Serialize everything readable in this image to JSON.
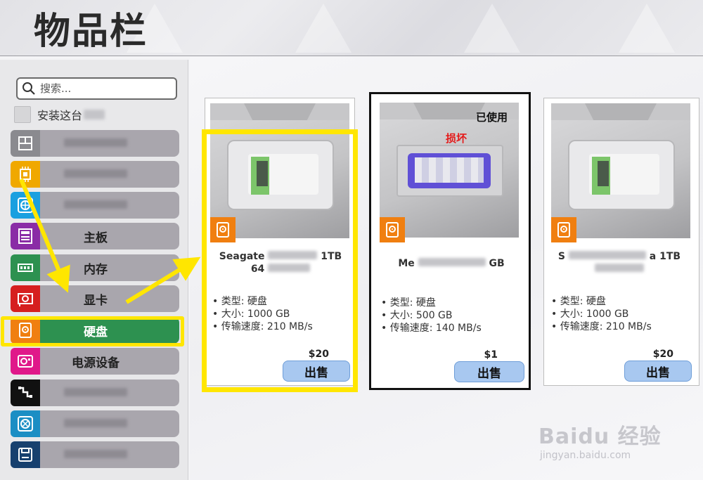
{
  "header": {
    "title": "物品栏"
  },
  "sidebar": {
    "search_placeholder": "搜索...",
    "install_label": "安装这台",
    "categories": [
      {
        "label": "",
        "icon": "case-icon",
        "color": "#8a8a8f"
      },
      {
        "label": "",
        "icon": "cpu-icon",
        "color": "#f0a800"
      },
      {
        "label": "",
        "icon": "cooler-icon",
        "color": "#1aa0e0"
      },
      {
        "label": "主板",
        "icon": "motherboard-icon",
        "color": "#8a2ca6"
      },
      {
        "label": "内存",
        "icon": "ram-icon",
        "color": "#2d9150"
      },
      {
        "label": "显卡",
        "icon": "gpu-icon",
        "color": "#d61f1f"
      },
      {
        "label": "硬盘",
        "icon": "hdd-icon",
        "color": "#f07f10"
      },
      {
        "label": "电源设备",
        "icon": "psu-icon",
        "color": "#e0188a"
      },
      {
        "label": "",
        "icon": "cable-icon",
        "color": "#111111"
      },
      {
        "label": "",
        "icon": "fan-icon",
        "color": "#1b8ec4"
      },
      {
        "label": "",
        "icon": "storage-icon",
        "color": "#17406e"
      }
    ]
  },
  "cards": [
    {
      "name_line1": "Seagate",
      "name_tail1": "1TB",
      "name_line2": "64",
      "specs": [
        "• 类型: 硬盘",
        "• 大小: 1000 GB",
        "• 传输速度: 210 MB/s"
      ],
      "price": "$20",
      "sell_label": "出售"
    },
    {
      "used_label": "已使用",
      "broken_label": "损坏",
      "name_line1": "Me",
      "name_tail1": "GB",
      "specs": [
        "• 类型: 硬盘",
        "• 大小: 500 GB",
        "• 传输速度: 140 MB/s"
      ],
      "price": "$1",
      "sell_label": "出售"
    },
    {
      "name_line1": "S",
      "name_tail1": "a 1TB",
      "specs": [
        "• 类型: 硬盘",
        "• 大小: 1000 GB",
        "• 传输速度: 210 MB/s"
      ],
      "price": "$20",
      "sell_label": "出售"
    }
  ],
  "watermark": {
    "main": "Baidu 经验",
    "sub": "jingyan.baidu.com"
  },
  "colors": {
    "active_category": "#2d9150",
    "highlight": "#ffe600",
    "sell_button": "#a8c8f0"
  }
}
